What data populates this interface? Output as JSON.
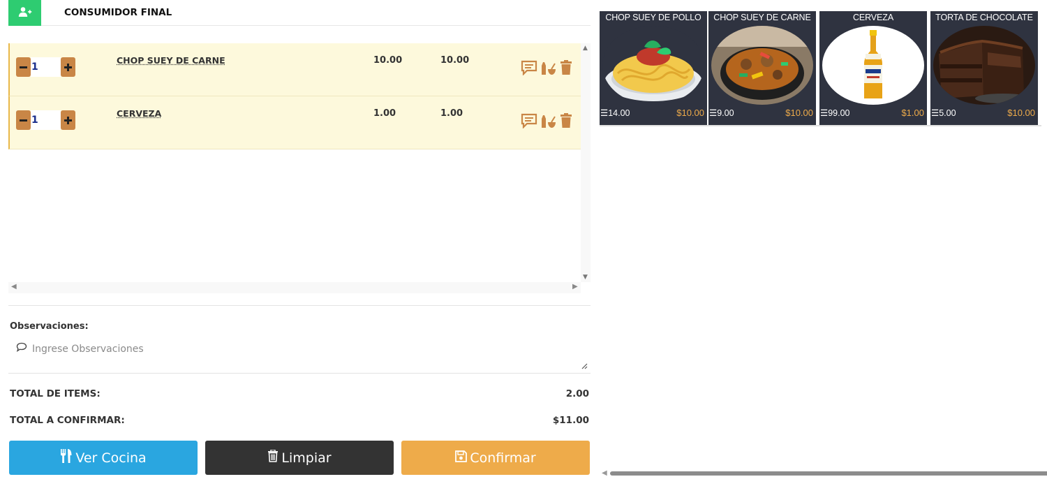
{
  "client": {
    "name": "CONSUMIDOR FINAL",
    "icon": "user-plus-icon"
  },
  "orders": [
    {
      "qty": "1",
      "product": "CHOP SUEY DE CARNE",
      "price": "10.00",
      "subtotal": "10.00"
    },
    {
      "qty": "1",
      "product": "CERVEZA",
      "price": "1.00",
      "subtotal": "1.00"
    }
  ],
  "observations": {
    "label": "Observaciones:",
    "placeholder": "Ingrese Observaciones"
  },
  "totals": {
    "items_label": "TOTAL DE ITEMS:",
    "items_value": "2.00",
    "confirm_label": "TOTAL A CONFIRMAR:",
    "confirm_value": "$11.00"
  },
  "buttons": {
    "cocina": "Ver Cocina",
    "limpiar": "Limpiar",
    "confirmar": "Confirmar"
  },
  "products": [
    {
      "title": "CHOP SUEY DE POLLO",
      "stock": "14.00",
      "price": "$10.00",
      "image": "spaghetti-plate"
    },
    {
      "title": "CHOP SUEY DE CARNE",
      "stock": "9.00",
      "price": "$10.00",
      "image": "stir-fry-bowl"
    },
    {
      "title": "CERVEZA",
      "stock": "99.00",
      "price": "$1.00",
      "image": "beer-bottle"
    },
    {
      "title": "TORTA DE CHOCOLATE",
      "stock": "5.00",
      "price": "$10.00",
      "image": "chocolate-cake"
    }
  ],
  "colors": {
    "client_button": "#2ecc71",
    "row_bg": "#fdf9dc",
    "qty_button": "#c98646",
    "cocina": "#2aa6e0",
    "limpiar": "#333333",
    "confirmar": "#eeab4a",
    "card_bg": "#2f3340",
    "price": "#eeab4a"
  }
}
